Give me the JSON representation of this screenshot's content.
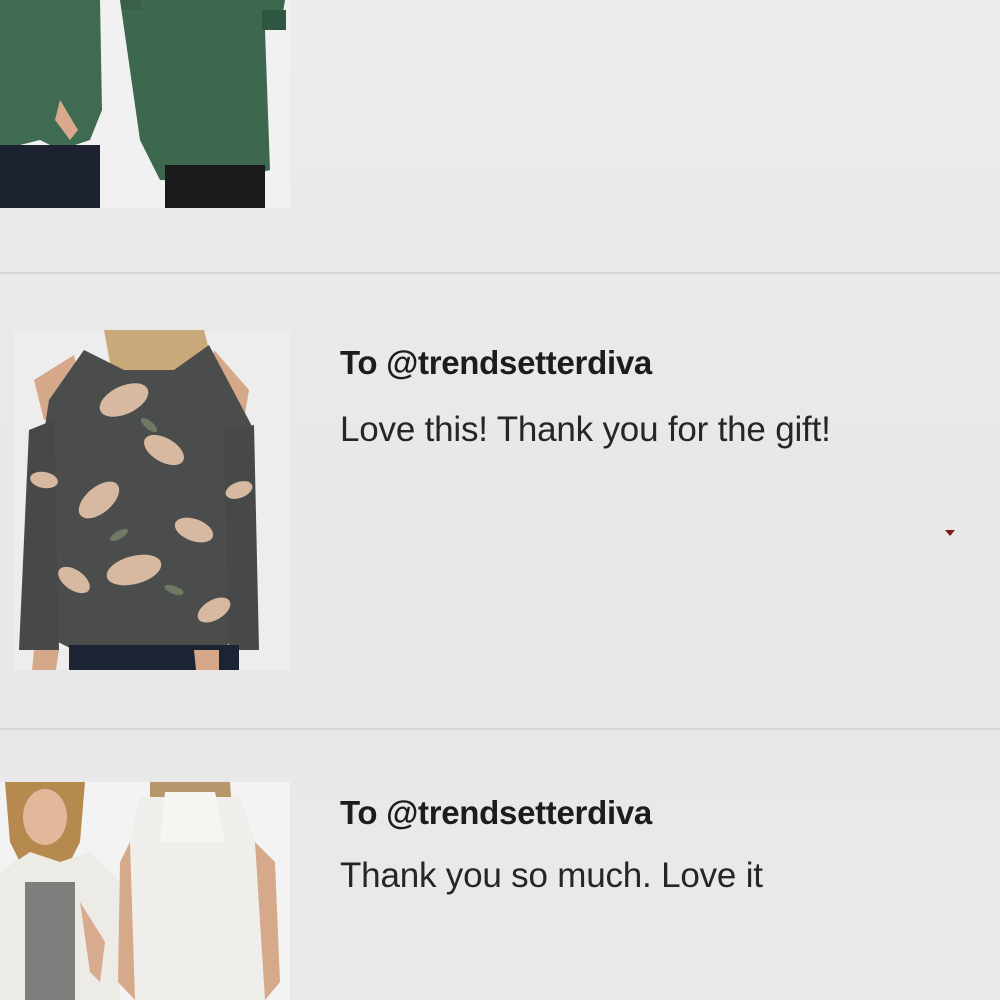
{
  "messages": [
    {
      "recipient": "",
      "text": "",
      "image_icon": "green-sweater-photo"
    },
    {
      "recipient": "To @trendsetterdiva",
      "text": "Love this! Thank you for the gift!",
      "image_icon": "floral-cold-shoulder-top-photo"
    },
    {
      "recipient": "To @trendsetterdiva",
      "text": "Thank you so much. Love it",
      "image_icon": "white-sherpa-vest-photo"
    }
  ],
  "colors": {
    "background": "#eaeaea",
    "divider": "#d6d6d6",
    "heading_text": "#1c1c1c",
    "body_text": "#262626",
    "green_sweater": "#3f6b52",
    "floral_top": "#4a4d4b",
    "floral_petal": "#d7b8a0"
  }
}
